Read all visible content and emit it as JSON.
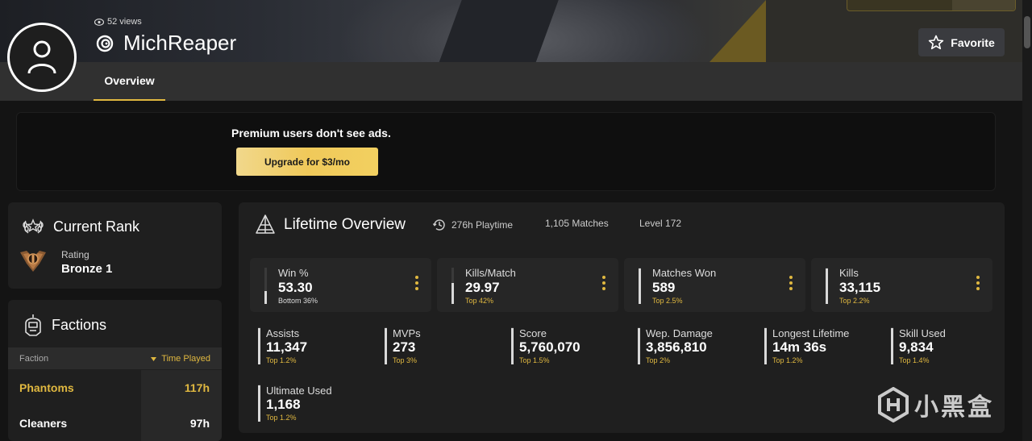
{
  "header": {
    "views": "52 views",
    "username": "MichReaper",
    "favorite_label": "Favorite",
    "tabs": [
      {
        "label": "Overview",
        "active": true
      }
    ]
  },
  "ad": {
    "message": "Premium users don't see ads.",
    "upgrade_label": "Upgrade for $3/mo"
  },
  "current_rank": {
    "title": "Current Rank",
    "rating_label": "Rating",
    "rating_value": "Bronze 1"
  },
  "factions": {
    "title": "Factions",
    "col_faction": "Faction",
    "col_time": "Time Played",
    "rows": [
      {
        "name": "Phantoms",
        "time": "117h"
      },
      {
        "name": "Cleaners",
        "time": "97h"
      }
    ]
  },
  "lifetime": {
    "title": "Lifetime Overview",
    "playtime": "276h Playtime",
    "matches": "1,105 Matches",
    "level": "Level 172",
    "big_stats": [
      {
        "label": "Win %",
        "value": "53.30",
        "rank": "Bottom 36%",
        "fill": 0.36
      },
      {
        "label": "Kills/Match",
        "value": "29.97",
        "rank": "Top 42%",
        "fill": 0.58
      },
      {
        "label": "Matches Won",
        "value": "589",
        "rank": "Top 2.5%",
        "fill": 0.975
      },
      {
        "label": "Kills",
        "value": "33,115",
        "rank": "Top 2.2%",
        "fill": 0.978
      }
    ],
    "small_stats": [
      {
        "label": "Assists",
        "value": "11,347",
        "rank": "Top 1.2%",
        "fill": 0.988
      },
      {
        "label": "MVPs",
        "value": "273",
        "rank": "Top 3%",
        "fill": 0.97
      },
      {
        "label": "Score",
        "value": "5,760,070",
        "rank": "Top 1.5%",
        "fill": 0.985
      },
      {
        "label": "Wep. Damage",
        "value": "3,856,810",
        "rank": "Top 2%",
        "fill": 0.98
      },
      {
        "label": "Longest Lifetime",
        "value": "14m 36s",
        "rank": "Top 1.2%",
        "fill": 0.988
      },
      {
        "label": "Skill Used",
        "value": "9,834",
        "rank": "Top 1.4%",
        "fill": 0.986
      },
      {
        "label": "Ultimate Used",
        "value": "1,168",
        "rank": "Top 1.2%",
        "fill": 0.988
      }
    ]
  },
  "watermark": {
    "text": "小黑盒"
  },
  "colors": {
    "accent": "#e0b840",
    "panel": "#1f1f1f",
    "background": "#141414"
  }
}
